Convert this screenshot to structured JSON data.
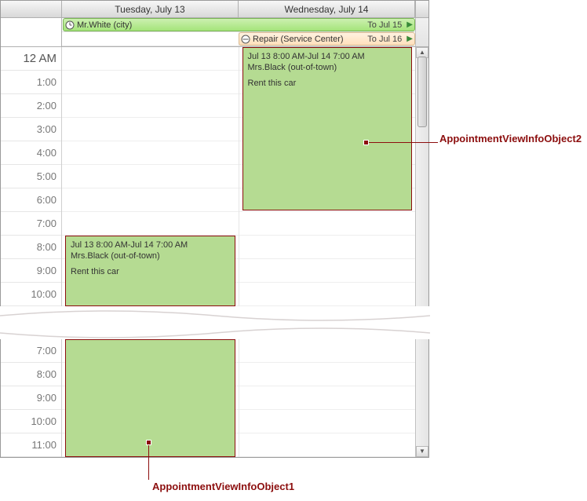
{
  "header": {
    "day1": "Tuesday, July 13",
    "day2": "Wednesday, July 14"
  },
  "allday": {
    "appt1": {
      "subject": "Mr.White (city)",
      "end_label": "To Jul 15"
    },
    "appt2": {
      "subject": "Repair (Service Center)",
      "end_label": "To Jul 16"
    }
  },
  "time_labels_top": {
    "t0": "12 AM",
    "t1": "1:00",
    "t2": "2:00",
    "t3": "3:00",
    "t4": "4:00",
    "t5": "5:00",
    "t6": "6:00",
    "t7": "7:00",
    "t8": "8:00",
    "t9": "9:00",
    "t10": "10:00"
  },
  "time_labels_bottom": {
    "b0": "7:00",
    "b1": "8:00",
    "b2": "9:00",
    "b3": "10:00",
    "b4": "11:00"
  },
  "appointment": {
    "time_range": "Jul 13 8:00 AM-Jul 14 7:00 AM",
    "title": "Mrs.Black (out-of-town)",
    "body": "Rent this car"
  },
  "annotations": {
    "obj1": "AppointmentViewInfoObject1",
    "obj2": "AppointmentViewInfoObject2"
  },
  "colors": {
    "appt_fill": "#b5db92",
    "callout": "#8c0e0e"
  }
}
